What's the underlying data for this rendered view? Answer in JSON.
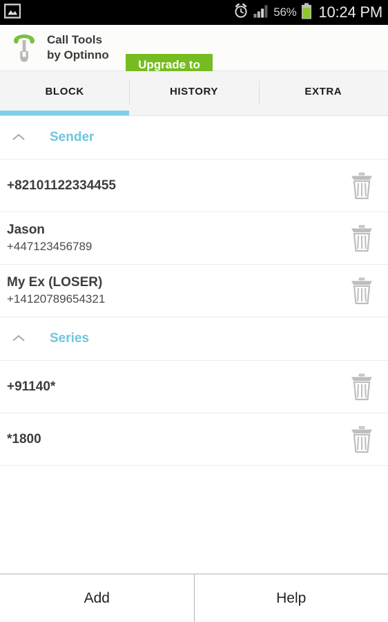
{
  "statusbar": {
    "notification_icon": "image-icon",
    "alarm_icon": "alarm-clock-icon",
    "signal_icon": "signal-bars-icon",
    "battery_percent": "56%",
    "battery_icon": "battery-icon",
    "clock": "10:24 PM",
    "battery_color": "#8bc926",
    "background": "#000000"
  },
  "appbar": {
    "logo_icon": "phone-wrench-logo-icon",
    "title": "Call Tools\nby Optinno",
    "upgrade_label": "Upgrade to\nPro",
    "upgrade_color": "#76bc21"
  },
  "tabs": {
    "active_index": 0,
    "accent": "#7ed0e8",
    "items": [
      {
        "label": "BLOCK"
      },
      {
        "label": "HISTORY"
      },
      {
        "label": "EXTRA"
      }
    ]
  },
  "sections": [
    {
      "title": "Sender",
      "collapse_icon": "chevron-up-icon",
      "color": "#6ec6de",
      "rows": [
        {
          "title": "+82101122334455",
          "subtitle": "",
          "delete_icon": "trash-icon"
        },
        {
          "title": "Jason",
          "subtitle": "+447123456789",
          "delete_icon": "trash-icon"
        },
        {
          "title": "My Ex (LOSER)",
          "subtitle": "+14120789654321",
          "delete_icon": "trash-icon"
        }
      ]
    },
    {
      "title": "Series",
      "collapse_icon": "chevron-up-icon",
      "color": "#6ec6de",
      "rows": [
        {
          "title": "+91140*",
          "subtitle": "",
          "delete_icon": "trash-icon"
        },
        {
          "title": "*1800",
          "subtitle": "",
          "delete_icon": "trash-icon"
        }
      ]
    }
  ],
  "bottombar": {
    "add_label": "Add",
    "help_label": "Help"
  }
}
